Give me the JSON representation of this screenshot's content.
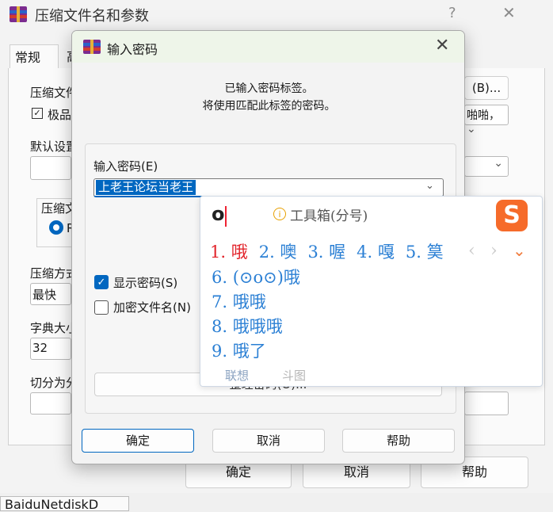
{
  "background_window": {
    "title": "压缩文件名和参数",
    "help_glyph": "?",
    "close_glyph": "✕",
    "tabs": [
      "常规",
      "高"
    ],
    "labels": {
      "archive_name": "压缩文件",
      "profile": "默认设置",
      "archive_format": "压缩文",
      "method": "压缩方式",
      "dict": "字典大小",
      "split": "切分为分"
    },
    "browse_button": "(B)...",
    "update_mode": "啪啪，",
    "checkbox_best": "极品",
    "method_value": "最快",
    "dict_value": "32",
    "radio_partial": "R",
    "buttons": {
      "ok": "确定",
      "cancel": "取消",
      "help": "帮助"
    },
    "status": "BaiduNetdiskD"
  },
  "dialog": {
    "title": "输入密码",
    "close_glyph": "✕",
    "message_line1": "已输入密码标签。",
    "message_line2": "将使用匹配此标签的密码。",
    "password_label": "输入密码(E)",
    "password_value": "上老王论坛当老王",
    "show_password": "显示密码(S)",
    "show_password_checked": true,
    "encrypt_names": "加密文件名(N)",
    "organize_partial": "整理密码(O)...",
    "buttons": {
      "ok": "确定",
      "cancel": "取消",
      "help": "帮助"
    }
  },
  "ime": {
    "input": "o",
    "tip": "工具箱(分号)",
    "tip_icon": "i",
    "logo": "S",
    "candidates": [
      "1. 哦",
      "2. 噢",
      "3. 喔",
      "4. 嘎",
      "5. 筽"
    ],
    "more_rows": [
      "6. (⊙o⊙)哦",
      "7. 哦哦",
      "8. 哦哦哦",
      "9. 哦了"
    ],
    "footer": [
      "联想",
      "斗图"
    ],
    "nav": {
      "prev": "‹",
      "next": "›",
      "more": "⌄"
    }
  }
}
